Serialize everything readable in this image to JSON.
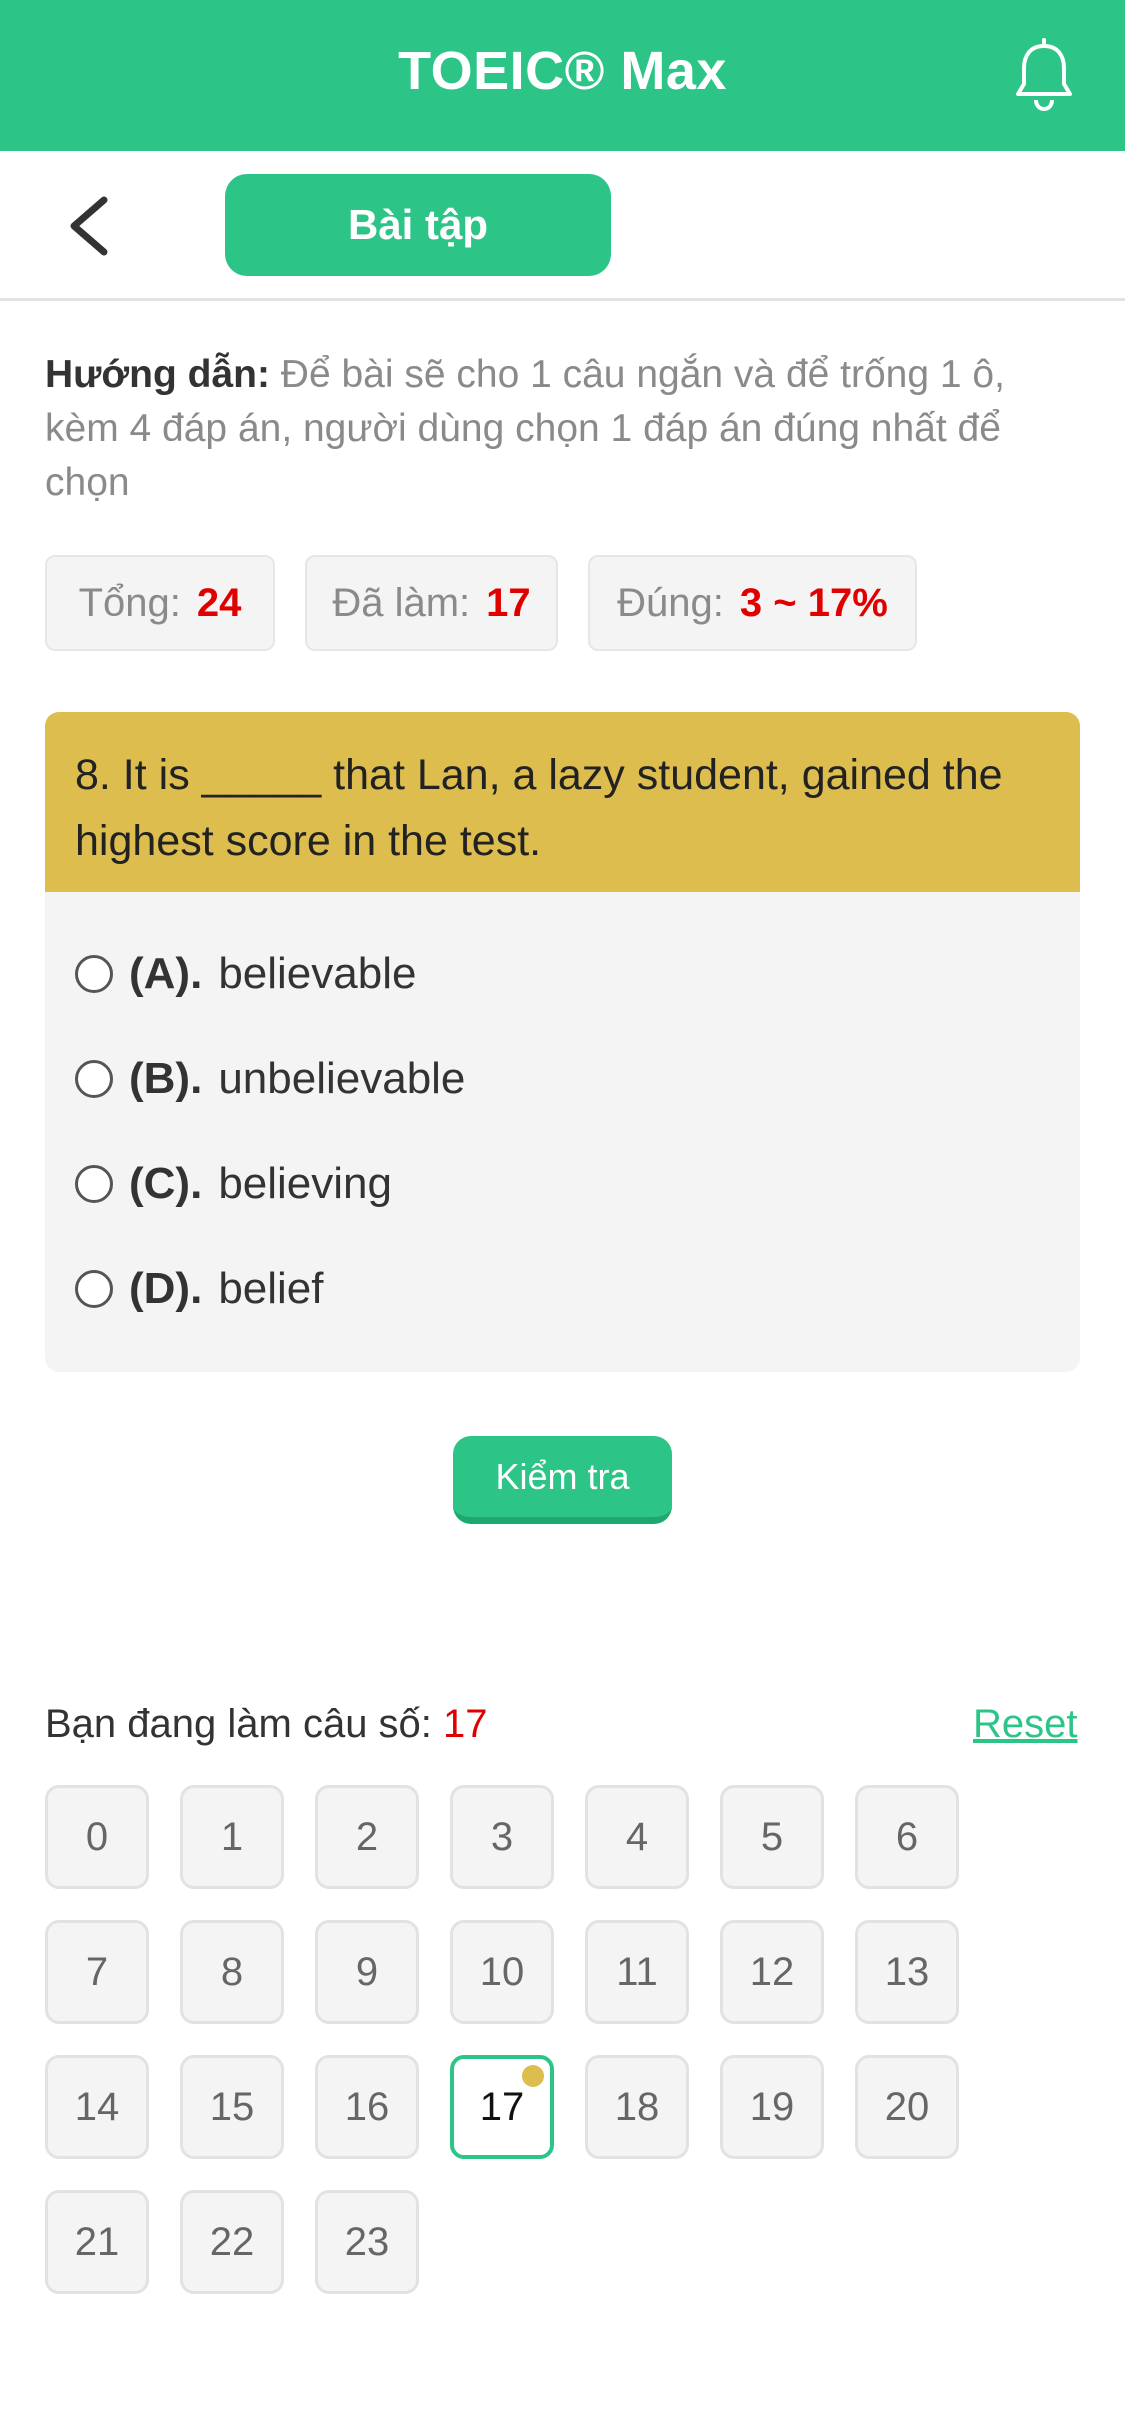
{
  "header": {
    "title": "TOEIC® Max",
    "icon": "bell-icon"
  },
  "subheader": {
    "back_icon": "chevron-left-icon",
    "tab_label": "Bài tập"
  },
  "instruction": {
    "label": "Hướng dẫn:",
    "text": "Để bài sẽ cho 1 câu ngắn và để trống 1 ô, kèm 4 đáp án, người dùng chọn 1 đáp án đúng nhất để chọn"
  },
  "stats": {
    "total_label": "Tổng:",
    "total_value": "24",
    "done_label": "Đã làm:",
    "done_value": "17",
    "correct_label": "Đúng:",
    "correct_value": "3 ~ 17%"
  },
  "question": {
    "text": "8. It is _____ that Lan, a lazy student, gained the highest score in the test.",
    "options": [
      {
        "key": "(A).",
        "text": "believable"
      },
      {
        "key": "(B).",
        "text": "unbelievable"
      },
      {
        "key": "(C).",
        "text": "believing"
      },
      {
        "key": "(D).",
        "text": "belief"
      }
    ]
  },
  "check_button": "Kiểm tra",
  "progress": {
    "label": "Bạn đang làm câu số:",
    "current": "17",
    "reset_label": "Reset"
  },
  "question_numbers": [
    "0",
    "1",
    "2",
    "3",
    "4",
    "5",
    "6",
    "7",
    "8",
    "9",
    "10",
    "11",
    "12",
    "13",
    "14",
    "15",
    "16",
    "17",
    "18",
    "19",
    "20",
    "21",
    "22",
    "23"
  ],
  "colors": {
    "primary": "#2dc488",
    "question_header": "#dcbd4e",
    "highlight": "#e00000"
  }
}
